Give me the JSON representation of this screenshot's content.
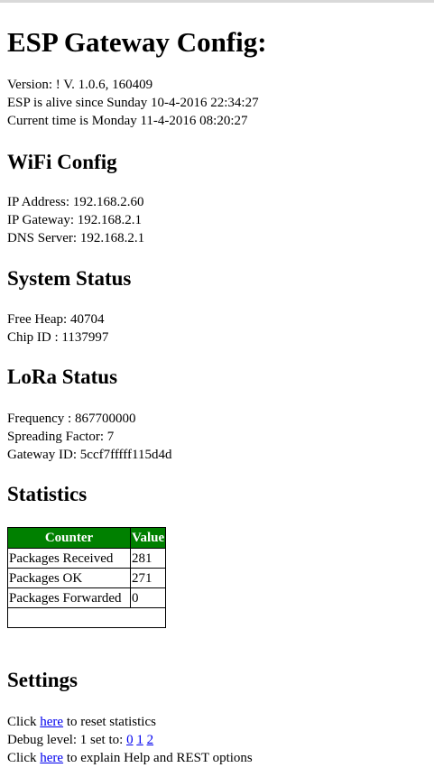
{
  "title": "ESP Gateway Config:",
  "header_info": {
    "version": "Version: ! V. 1.0.6, 160409",
    "alive": "ESP is alive since Sunday 10-4-2016 22:34:27",
    "current_time": "Current time is Monday 11-4-2016 08:20:27"
  },
  "wifi": {
    "heading": "WiFi Config",
    "ip_address": "IP Address: 192.168.2.60",
    "ip_gateway": "IP Gateway: 192.168.2.1",
    "dns_server": "DNS Server: 192.168.2.1"
  },
  "system": {
    "heading": "System Status",
    "free_heap": "Free Heap: 40704",
    "chip_id": "Chip ID : 1137997"
  },
  "lora": {
    "heading": "LoRa Status",
    "frequency": "Frequency : 867700000",
    "spreading_factor": "Spreading Factor: 7",
    "gateway_id": "Gateway ID: 5ccf7fffff115d4d"
  },
  "statistics": {
    "heading": "Statistics",
    "columns": [
      "Counter",
      "Value"
    ],
    "rows": [
      {
        "counter": "Packages Received",
        "value": "281"
      },
      {
        "counter": "Packages OK",
        "value": "271"
      },
      {
        "counter": "Packages Forwarded",
        "value": "0"
      }
    ],
    "header_color": "#008000"
  },
  "settings": {
    "heading": "Settings",
    "reset_prefix": "Click ",
    "reset_link": "here",
    "reset_suffix": " to reset statistics",
    "debug_prefix": "Debug level: 1 set to: ",
    "debug_options": [
      "0",
      "1",
      "2"
    ],
    "help_prefix": "Click ",
    "help_link": "here",
    "help_suffix": " to explain Help and REST options"
  },
  "colors": {
    "link": "#0000ee",
    "table_header": "#008000"
  }
}
